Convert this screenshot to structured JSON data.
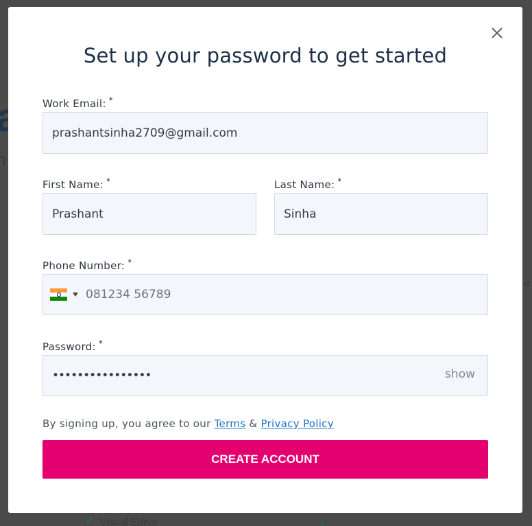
{
  "modal": {
    "title": "Set up your password to get started",
    "close_icon": "close-icon"
  },
  "form": {
    "email": {
      "label": "Work Email:",
      "required_mark": "*",
      "value": "prashantsinha2709@gmail.com"
    },
    "first_name": {
      "label": "First Name:",
      "required_mark": "*",
      "value": "Prashant"
    },
    "last_name": {
      "label": "Last Name:",
      "required_mark": "*",
      "value": "Sinha"
    },
    "phone": {
      "label": "Phone Number:",
      "required_mark": "*",
      "country_flag": "india-flag-icon",
      "value": "081234 56789"
    },
    "password": {
      "label": "Password:",
      "required_mark": "*",
      "masked_value": "••••••••••••••••",
      "show_label": "show"
    }
  },
  "consent": {
    "text": "By signing up, you agree to our",
    "terms_link": "Terms",
    "ampersand": "&",
    "privacy_link": "Privacy Policy"
  },
  "submit": {
    "label": "CREATE ACCOUNT"
  },
  "colors": {
    "primary_button": "#e4006e",
    "title_text": "#1d3047",
    "link": "#1a73c8",
    "input_bg": "#f3f6fa",
    "overlay": "#4a4a4a"
  }
}
